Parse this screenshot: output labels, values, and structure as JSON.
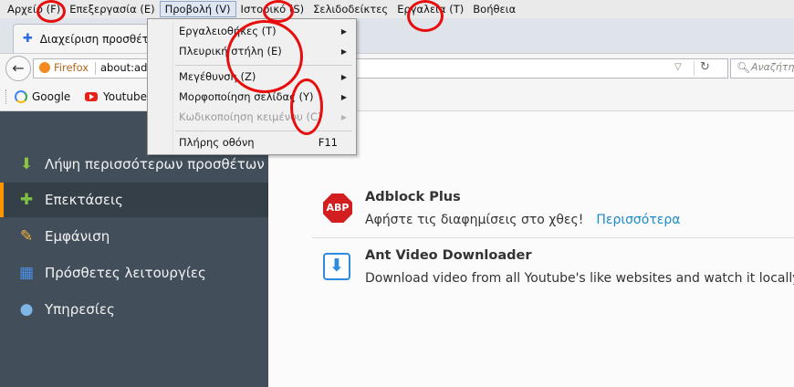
{
  "menubar": {
    "items": [
      "Αρχείο (F)",
      "Επεξεργασία (E)",
      "Προβολή (V)",
      "Ιστορικό (S)",
      "Σελιδοδείκτες",
      "Εργαλεία (T)",
      "Βοήθεια"
    ]
  },
  "tab": {
    "title": "Διαχείριση προσθέτων"
  },
  "navbar": {
    "identity_label": "Firefox",
    "url": "about:addons",
    "search_placeholder": "Αναζήτηση"
  },
  "bookmarks": [
    "Google",
    "Youtube"
  ],
  "sidebar": {
    "items": [
      {
        "label": "Λήψη περισσότερων προσθέτων",
        "icon": "download-addons-icon"
      },
      {
        "label": "Επεκτάσεις",
        "icon": "puzzle-icon"
      },
      {
        "label": "Εμφάνιση",
        "icon": "paintbrush-icon"
      },
      {
        "label": "Πρόσθετες λειτουργίες",
        "icon": "plugin-icon"
      },
      {
        "label": "Υπηρεσίες",
        "icon": "chat-bubble-icon"
      }
    ],
    "selected": "Επεκτάσεις"
  },
  "addons": [
    {
      "name": "Adblock Plus",
      "description": "Αφήστε τις διαφημίσεις στο χθες!",
      "more_link": "Περισσότερα",
      "icon_text": "ABP"
    },
    {
      "name": "Ant Video Downloader",
      "description": "Download video from all Youtube's like websites and watch it locally."
    }
  ],
  "view_menu": {
    "items": [
      {
        "label": "Εργαλειοθήκες (T)",
        "submenu": true,
        "disabled": false
      },
      {
        "label": "Πλευρική στήλη (E)",
        "submenu": true,
        "disabled": false
      },
      {
        "label": "Μεγέθυνση (Z)",
        "submenu": true,
        "disabled": false
      },
      {
        "label": "Μορφοποίηση σελίδας (Y)",
        "submenu": true,
        "disabled": false
      },
      {
        "label": "Κωδικοποίηση κειμένου (C)",
        "submenu": true,
        "disabled": true
      },
      {
        "label": "Πλήρης οθόνη",
        "shortcut": "F11",
        "submenu": false,
        "disabled": false
      }
    ]
  },
  "colors": {
    "annotation_circle": "#e80d0d",
    "sidebar_bg": "#424f5a",
    "selected_accent": "#ff9500",
    "link": "#1a8bc8"
  }
}
